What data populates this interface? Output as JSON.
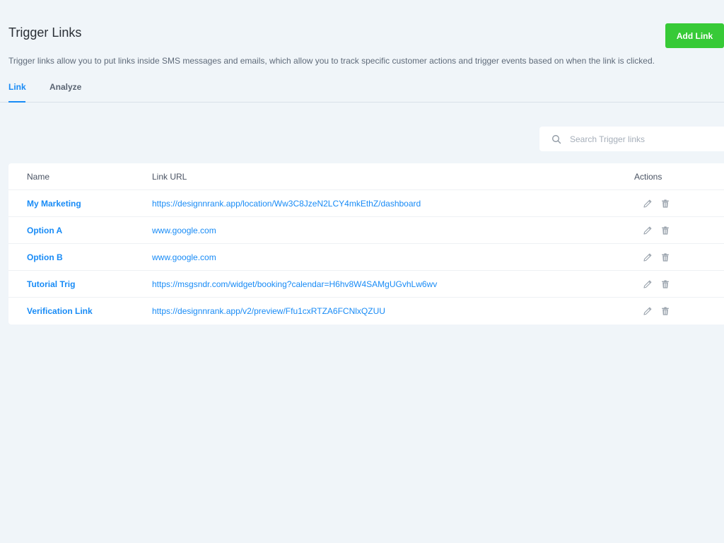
{
  "header": {
    "title": "Trigger Links",
    "add_button_label": "Add Link",
    "description": "Trigger links allow you to put links inside SMS messages and emails, which allow you to track specific customer actions and trigger events based on when the link is clicked."
  },
  "tabs": [
    {
      "label": "Link",
      "active": true
    },
    {
      "label": "Analyze",
      "active": false
    }
  ],
  "search": {
    "placeholder": "Search Trigger links",
    "value": ""
  },
  "table": {
    "columns": {
      "name": "Name",
      "url": "Link URL",
      "actions": "Actions"
    },
    "rows": [
      {
        "name": "My Marketing",
        "url": "https://designnrank.app/location/Ww3C8JzeN2LCY4mkEthZ/dashboard"
      },
      {
        "name": "Option A",
        "url": "www.google.com"
      },
      {
        "name": "Option B",
        "url": "www.google.com"
      },
      {
        "name": "Tutorial Trig",
        "url": "https://msgsndr.com/widget/booking?calendar=H6hv8W4SAMgUGvhLw6wv"
      },
      {
        "name": "Verification Link",
        "url": "https://designnrank.app/v2/preview/Ffu1cxRTZA6FCNlxQZUU"
      }
    ],
    "row_icons": [
      "pencil-icon",
      "trash-icon"
    ]
  },
  "colors": {
    "accent": "#188bf6",
    "add_button": "#37ca37",
    "background": "#f0f5f9"
  }
}
